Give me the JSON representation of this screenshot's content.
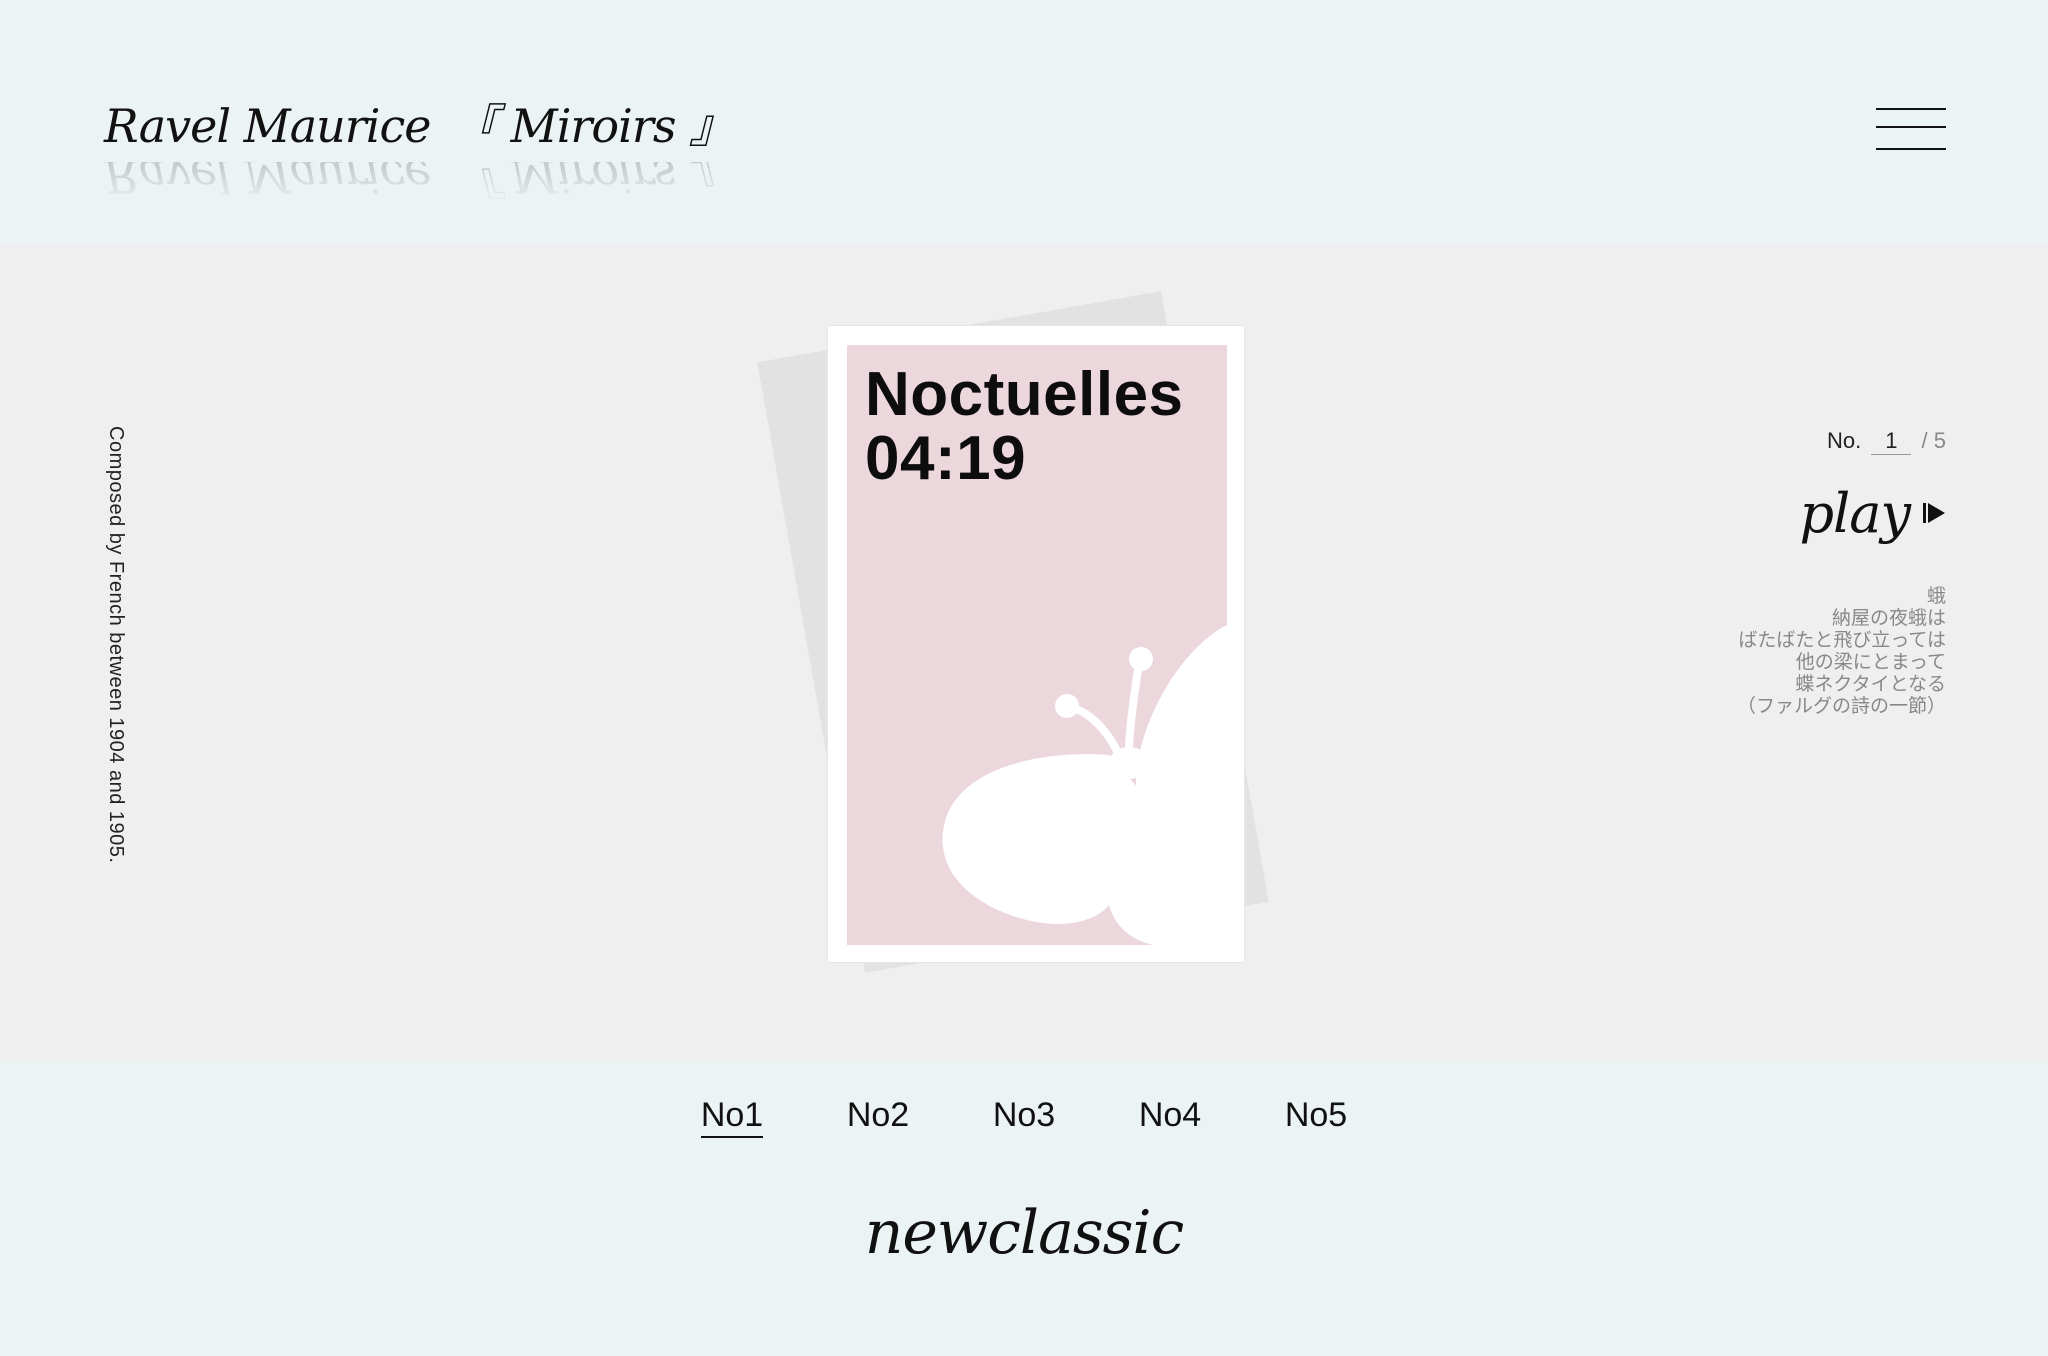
{
  "header": {
    "composer": "Ravel Maurice",
    "album": "『 Miroirs 』"
  },
  "sidebar": {
    "caption": "Composed by French between 1904 and 1905."
  },
  "card": {
    "title": "Noctuelles",
    "duration": "04:19",
    "background_color": "#ecd7dc"
  },
  "player": {
    "number_label": "No.",
    "current_number": "1",
    "total": "/ 5",
    "play_label": "play"
  },
  "poem": {
    "lines": [
      "蛾",
      "納屋の夜蛾は",
      "ばたばたと飛び立っては",
      "他の梁にとまって",
      "蝶ネクタイとなる",
      "（ファルグの詩の一節）"
    ]
  },
  "tracks": [
    {
      "label": "No1",
      "active": true
    },
    {
      "label": "No2",
      "active": false
    },
    {
      "label": "No3",
      "active": false
    },
    {
      "label": "No4",
      "active": false
    },
    {
      "label": "No5",
      "active": false
    }
  ],
  "footer": {
    "logo": "newclassic"
  },
  "icons": {
    "menu": "hamburger-icon",
    "play": "play-icon",
    "artwork": "moth-icon"
  }
}
